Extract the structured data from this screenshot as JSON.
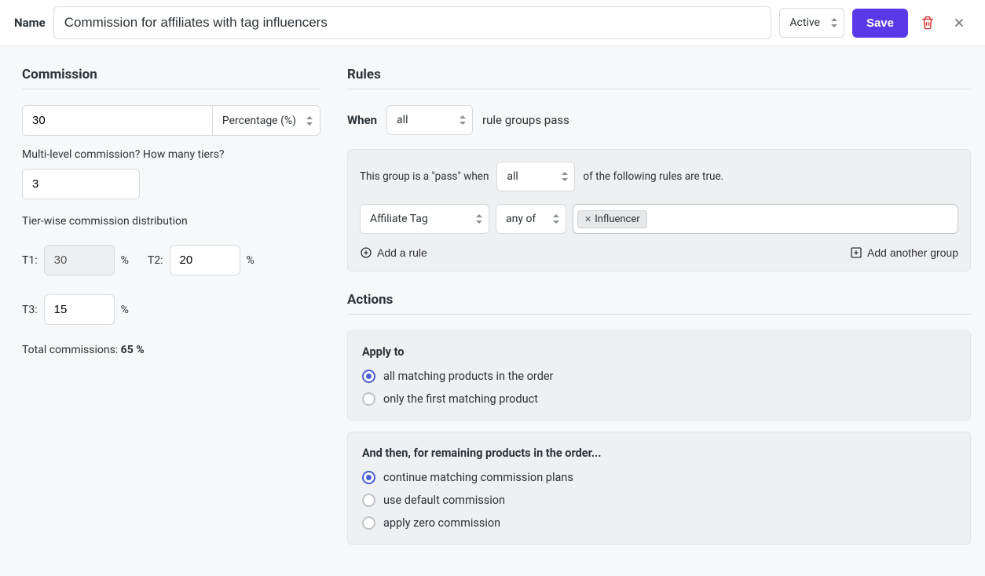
{
  "header": {
    "name_label": "Name",
    "name_value": "Commission for affiliates with tag influencers",
    "status": "Active",
    "save_label": "Save"
  },
  "commission": {
    "title": "Commission",
    "amount": "30",
    "type_label": "Percentage (%)",
    "mlm_label": "Multi-level commission? How many tiers?",
    "tiers_count": "3",
    "tier_dist_label": "Tier-wise commission distribution",
    "tiers": [
      {
        "label": "T1:",
        "value": "30",
        "readonly": true
      },
      {
        "label": "T2:",
        "value": "20",
        "readonly": false
      },
      {
        "label": "T3:",
        "value": "15",
        "readonly": false
      }
    ],
    "pct_sign": "%",
    "total_prefix": "Total commissions: ",
    "total_value": "65 %"
  },
  "rules": {
    "title": "Rules",
    "when_label": "When",
    "when_select": "all",
    "when_suffix": "rule groups pass",
    "group_prefix": "This group is a \"pass\" when",
    "group_select": "all",
    "group_suffix": "of the following rules are true.",
    "rule_field": "Affiliate Tag",
    "rule_op": "any of",
    "rule_tag": "Influencer",
    "add_rule": "Add a rule",
    "add_group": "Add another group"
  },
  "actions": {
    "title": "Actions",
    "apply_to_label": "Apply to",
    "apply_opts": [
      {
        "text": "all matching products in the order",
        "selected": true
      },
      {
        "text": "only the first matching product",
        "selected": false
      }
    ],
    "then_label": "And then, for remaining products in the order...",
    "then_opts": [
      {
        "text": "continue matching commission plans",
        "selected": true
      },
      {
        "text": "use default commission",
        "selected": false
      },
      {
        "text": "apply zero commission",
        "selected": false
      }
    ]
  }
}
